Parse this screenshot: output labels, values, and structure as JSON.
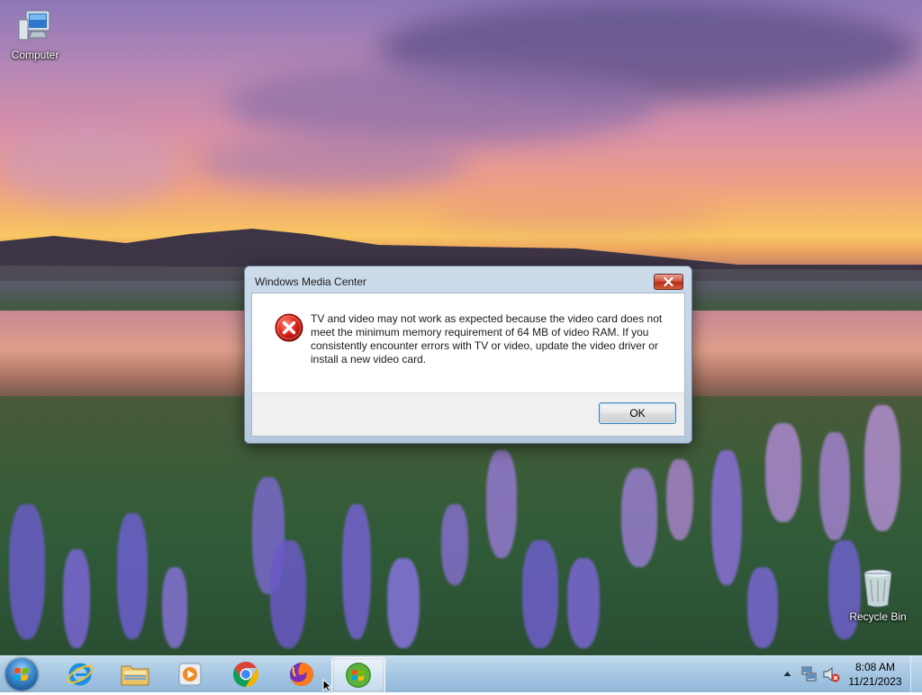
{
  "desktop": {
    "icons": [
      {
        "label": "Computer"
      },
      {
        "label": "Recycle Bin"
      }
    ]
  },
  "dialog": {
    "title": "Windows Media Center",
    "message": "TV and video may not work as expected because the video card does not meet the minimum memory requirement of 64 MB of video RAM. If you consistently encounter errors with TV or video, update the video driver or install a new video card.",
    "ok_label": "OK"
  },
  "taskbar": {
    "pinned": [
      {
        "icon": "internet-explorer-icon"
      },
      {
        "icon": "file-explorer-icon"
      },
      {
        "icon": "media-player-icon"
      },
      {
        "icon": "chrome-icon"
      },
      {
        "icon": "firefox-icon"
      },
      {
        "icon": "windows-media-center-icon",
        "active": true
      }
    ],
    "clock": {
      "time": "8:08 AM",
      "date": "11/21/2023"
    }
  }
}
